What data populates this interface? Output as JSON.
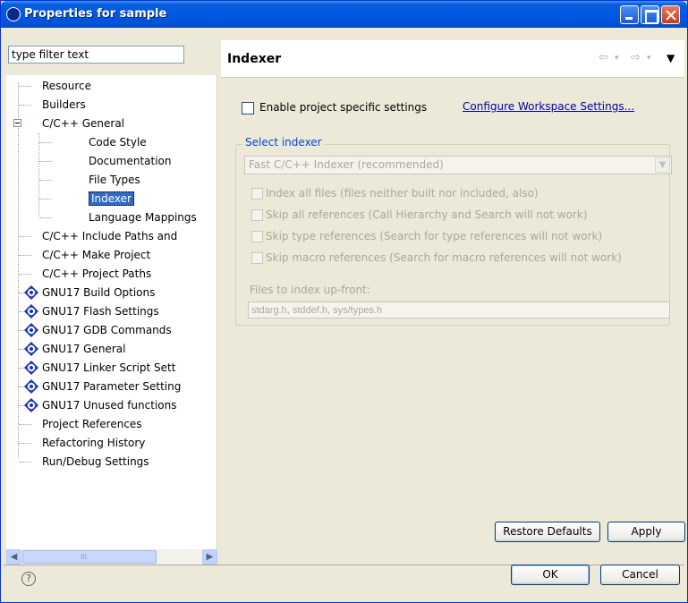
{
  "window": {
    "title": "Properties for sample"
  },
  "left": {
    "filter_text": "type filter text",
    "tree": [
      {
        "label": "Resource",
        "depth": 0,
        "icon": ""
      },
      {
        "label": "Builders",
        "depth": 0,
        "icon": ""
      },
      {
        "label": "C/C++ General",
        "depth": 0,
        "icon": "",
        "expanded": true
      },
      {
        "label": "Code Style",
        "depth": 1,
        "icon": ""
      },
      {
        "label": "Documentation",
        "depth": 1,
        "icon": ""
      },
      {
        "label": "File Types",
        "depth": 1,
        "icon": ""
      },
      {
        "label": "Indexer",
        "depth": 1,
        "icon": "",
        "selected": true
      },
      {
        "label": "Language Mappings",
        "depth": 1,
        "icon": ""
      },
      {
        "label": "C/C++ Include Paths and",
        "depth": 0,
        "icon": ""
      },
      {
        "label": "C/C++ Make Project",
        "depth": 0,
        "icon": ""
      },
      {
        "label": "C/C++ Project Paths",
        "depth": 0,
        "icon": ""
      },
      {
        "label": "GNU17 Build Options",
        "depth": 0,
        "icon": "gnu-icon"
      },
      {
        "label": "GNU17 Flash Settings",
        "depth": 0,
        "icon": "gnu-icon"
      },
      {
        "label": "GNU17 GDB Commands",
        "depth": 0,
        "icon": "gnu-icon"
      },
      {
        "label": "GNU17 General",
        "depth": 0,
        "icon": "gnu-icon"
      },
      {
        "label": "GNU17 Linker Script Sett",
        "depth": 0,
        "icon": "gnu-icon"
      },
      {
        "label": "GNU17 Parameter Setting",
        "depth": 0,
        "icon": "gnu-icon"
      },
      {
        "label": "GNU17 Unused functions",
        "depth": 0,
        "icon": "gnu-icon"
      },
      {
        "label": "Project References",
        "depth": 0,
        "icon": ""
      },
      {
        "label": "Refactoring History",
        "depth": 0,
        "icon": ""
      },
      {
        "label": "Run/Debug Settings",
        "depth": 0,
        "icon": ""
      }
    ],
    "scroll_mid": "III"
  },
  "right": {
    "title": "Indexer",
    "enable_label": "Enable project specific settings",
    "configure_link": "Configure Workspace Settings...",
    "group_title": "Select indexer",
    "indexer_combo": "Fast C/C++ Indexer (recommended)",
    "options": [
      "Index all files (files neither built nor included, also)",
      "Skip all references (Call Hierarchy and Search will not work)",
      "Skip type references (Search for type references will not work)",
      "Skip macro references (Search for macro references will not work)"
    ],
    "files_label": "Files to index up-front:",
    "files_value": "stdarg.h, stddef.h, sys/types.h",
    "restore_label": "Restore Defaults",
    "apply_label": "Apply"
  },
  "footer": {
    "ok_label": "OK",
    "cancel_label": "Cancel"
  },
  "colors": {
    "title_bar": "#0058e6",
    "selection": "#316ac5",
    "link": "#0000aa",
    "group_title": "#0046d5"
  }
}
